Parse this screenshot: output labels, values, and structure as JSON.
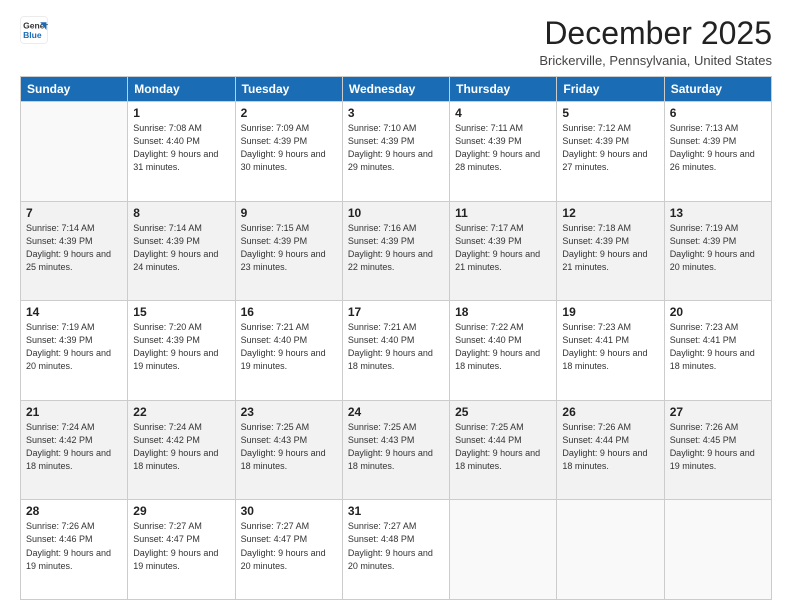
{
  "header": {
    "logo_line1": "General",
    "logo_line2": "Blue",
    "month_title": "December 2025",
    "location": "Brickerville, Pennsylvania, United States"
  },
  "days_of_week": [
    "Sunday",
    "Monday",
    "Tuesday",
    "Wednesday",
    "Thursday",
    "Friday",
    "Saturday"
  ],
  "weeks": [
    [
      {
        "day": "",
        "sunrise": "",
        "sunset": "",
        "daylight": ""
      },
      {
        "day": "1",
        "sunrise": "7:08 AM",
        "sunset": "4:40 PM",
        "daylight": "9 hours and 31 minutes."
      },
      {
        "day": "2",
        "sunrise": "7:09 AM",
        "sunset": "4:39 PM",
        "daylight": "9 hours and 30 minutes."
      },
      {
        "day": "3",
        "sunrise": "7:10 AM",
        "sunset": "4:39 PM",
        "daylight": "9 hours and 29 minutes."
      },
      {
        "day": "4",
        "sunrise": "7:11 AM",
        "sunset": "4:39 PM",
        "daylight": "9 hours and 28 minutes."
      },
      {
        "day": "5",
        "sunrise": "7:12 AM",
        "sunset": "4:39 PM",
        "daylight": "9 hours and 27 minutes."
      },
      {
        "day": "6",
        "sunrise": "7:13 AM",
        "sunset": "4:39 PM",
        "daylight": "9 hours and 26 minutes."
      }
    ],
    [
      {
        "day": "7",
        "sunrise": "7:14 AM",
        "sunset": "4:39 PM",
        "daylight": "9 hours and 25 minutes."
      },
      {
        "day": "8",
        "sunrise": "7:14 AM",
        "sunset": "4:39 PM",
        "daylight": "9 hours and 24 minutes."
      },
      {
        "day": "9",
        "sunrise": "7:15 AM",
        "sunset": "4:39 PM",
        "daylight": "9 hours and 23 minutes."
      },
      {
        "day": "10",
        "sunrise": "7:16 AM",
        "sunset": "4:39 PM",
        "daylight": "9 hours and 22 minutes."
      },
      {
        "day": "11",
        "sunrise": "7:17 AM",
        "sunset": "4:39 PM",
        "daylight": "9 hours and 21 minutes."
      },
      {
        "day": "12",
        "sunrise": "7:18 AM",
        "sunset": "4:39 PM",
        "daylight": "9 hours and 21 minutes."
      },
      {
        "day": "13",
        "sunrise": "7:19 AM",
        "sunset": "4:39 PM",
        "daylight": "9 hours and 20 minutes."
      }
    ],
    [
      {
        "day": "14",
        "sunrise": "7:19 AM",
        "sunset": "4:39 PM",
        "daylight": "9 hours and 20 minutes."
      },
      {
        "day": "15",
        "sunrise": "7:20 AM",
        "sunset": "4:39 PM",
        "daylight": "9 hours and 19 minutes."
      },
      {
        "day": "16",
        "sunrise": "7:21 AM",
        "sunset": "4:40 PM",
        "daylight": "9 hours and 19 minutes."
      },
      {
        "day": "17",
        "sunrise": "7:21 AM",
        "sunset": "4:40 PM",
        "daylight": "9 hours and 18 minutes."
      },
      {
        "day": "18",
        "sunrise": "7:22 AM",
        "sunset": "4:40 PM",
        "daylight": "9 hours and 18 minutes."
      },
      {
        "day": "19",
        "sunrise": "7:23 AM",
        "sunset": "4:41 PM",
        "daylight": "9 hours and 18 minutes."
      },
      {
        "day": "20",
        "sunrise": "7:23 AM",
        "sunset": "4:41 PM",
        "daylight": "9 hours and 18 minutes."
      }
    ],
    [
      {
        "day": "21",
        "sunrise": "7:24 AM",
        "sunset": "4:42 PM",
        "daylight": "9 hours and 18 minutes."
      },
      {
        "day": "22",
        "sunrise": "7:24 AM",
        "sunset": "4:42 PM",
        "daylight": "9 hours and 18 minutes."
      },
      {
        "day": "23",
        "sunrise": "7:25 AM",
        "sunset": "4:43 PM",
        "daylight": "9 hours and 18 minutes."
      },
      {
        "day": "24",
        "sunrise": "7:25 AM",
        "sunset": "4:43 PM",
        "daylight": "9 hours and 18 minutes."
      },
      {
        "day": "25",
        "sunrise": "7:25 AM",
        "sunset": "4:44 PM",
        "daylight": "9 hours and 18 minutes."
      },
      {
        "day": "26",
        "sunrise": "7:26 AM",
        "sunset": "4:44 PM",
        "daylight": "9 hours and 18 minutes."
      },
      {
        "day": "27",
        "sunrise": "7:26 AM",
        "sunset": "4:45 PM",
        "daylight": "9 hours and 19 minutes."
      }
    ],
    [
      {
        "day": "28",
        "sunrise": "7:26 AM",
        "sunset": "4:46 PM",
        "daylight": "9 hours and 19 minutes."
      },
      {
        "day": "29",
        "sunrise": "7:27 AM",
        "sunset": "4:47 PM",
        "daylight": "9 hours and 19 minutes."
      },
      {
        "day": "30",
        "sunrise": "7:27 AM",
        "sunset": "4:47 PM",
        "daylight": "9 hours and 20 minutes."
      },
      {
        "day": "31",
        "sunrise": "7:27 AM",
        "sunset": "4:48 PM",
        "daylight": "9 hours and 20 minutes."
      },
      {
        "day": "",
        "sunrise": "",
        "sunset": "",
        "daylight": ""
      },
      {
        "day": "",
        "sunrise": "",
        "sunset": "",
        "daylight": ""
      },
      {
        "day": "",
        "sunrise": "",
        "sunset": "",
        "daylight": ""
      }
    ]
  ]
}
